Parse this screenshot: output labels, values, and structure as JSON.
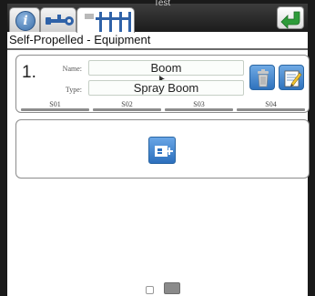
{
  "window": {
    "title": "Test"
  },
  "tabs": [
    {
      "label": "i",
      "icon": "info-icon"
    },
    {
      "label": "",
      "icon": "tools-icon"
    },
    {
      "label": "",
      "icon": "equipment-icon"
    }
  ],
  "page": {
    "title": "Self-Propelled - Equipment"
  },
  "equipment": {
    "number": "1.",
    "name_label": "Name:",
    "name_value": "Boom",
    "type_label": "Type:",
    "type_value": "Spray Boom",
    "sections": [
      "S01",
      "S02",
      "S03",
      "S04"
    ]
  },
  "icons": {
    "delete": "trash-icon",
    "edit": "edit-notepad-icon",
    "add": "add-equipment-icon",
    "back": "back-arrow-icon"
  },
  "colors": {
    "accent_blue": "#2f72bd",
    "back_green": "#2e9b3a"
  },
  "pager": {
    "pages": 2,
    "current": 2
  }
}
